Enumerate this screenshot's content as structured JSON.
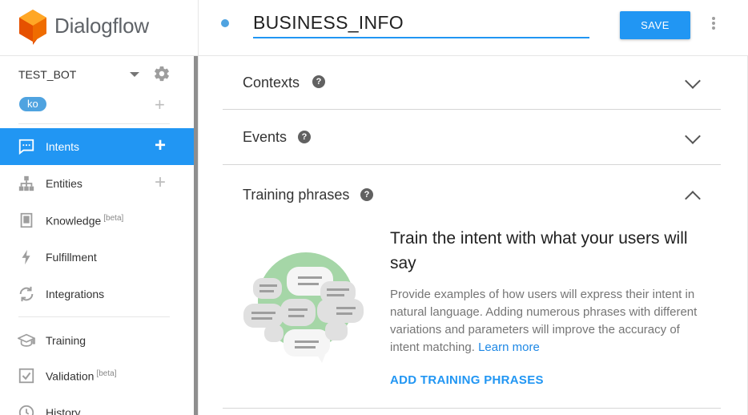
{
  "app": {
    "name": "Dialogflow"
  },
  "agent": {
    "name": "TEST_BOT",
    "language": "ko"
  },
  "sidebar": {
    "items": [
      {
        "label": "Intents",
        "badge": "",
        "active": true
      },
      {
        "label": "Entities",
        "badge": ""
      },
      {
        "label": "Knowledge",
        "badge": "[beta]"
      },
      {
        "label": "Fulfillment",
        "badge": ""
      },
      {
        "label": "Integrations",
        "badge": ""
      },
      {
        "label": "Training",
        "badge": ""
      },
      {
        "label": "Validation",
        "badge": "[beta]"
      },
      {
        "label": "History",
        "badge": ""
      }
    ],
    "add_symbol": "+"
  },
  "header": {
    "intent_name": "BUSINESS_INFO",
    "save_label": "SAVE"
  },
  "sections": {
    "contexts": {
      "title": "Contexts"
    },
    "events": {
      "title": "Events"
    },
    "training": {
      "title": "Training phrases",
      "heading": "Train the intent with what your users will say",
      "description": "Provide examples of how users will express their intent in natural language. Adding numerous phrases with different variations and parameters will improve the accuracy of intent matching.",
      "learn_more": "Learn more",
      "add_button": "ADD TRAINING PHRASES"
    }
  },
  "help_symbol": "?",
  "colors": {
    "accent": "#2196f3",
    "logo": "#ef6c00",
    "illustration_green": "#a5d6a7"
  },
  "icons": [
    "gear-icon",
    "intents-icon",
    "entities-icon",
    "knowledge-icon",
    "fulfillment-icon",
    "integrations-icon",
    "training-icon",
    "validation-icon",
    "history-icon",
    "more-vert-icon",
    "help-icon",
    "chevron-icon"
  ]
}
